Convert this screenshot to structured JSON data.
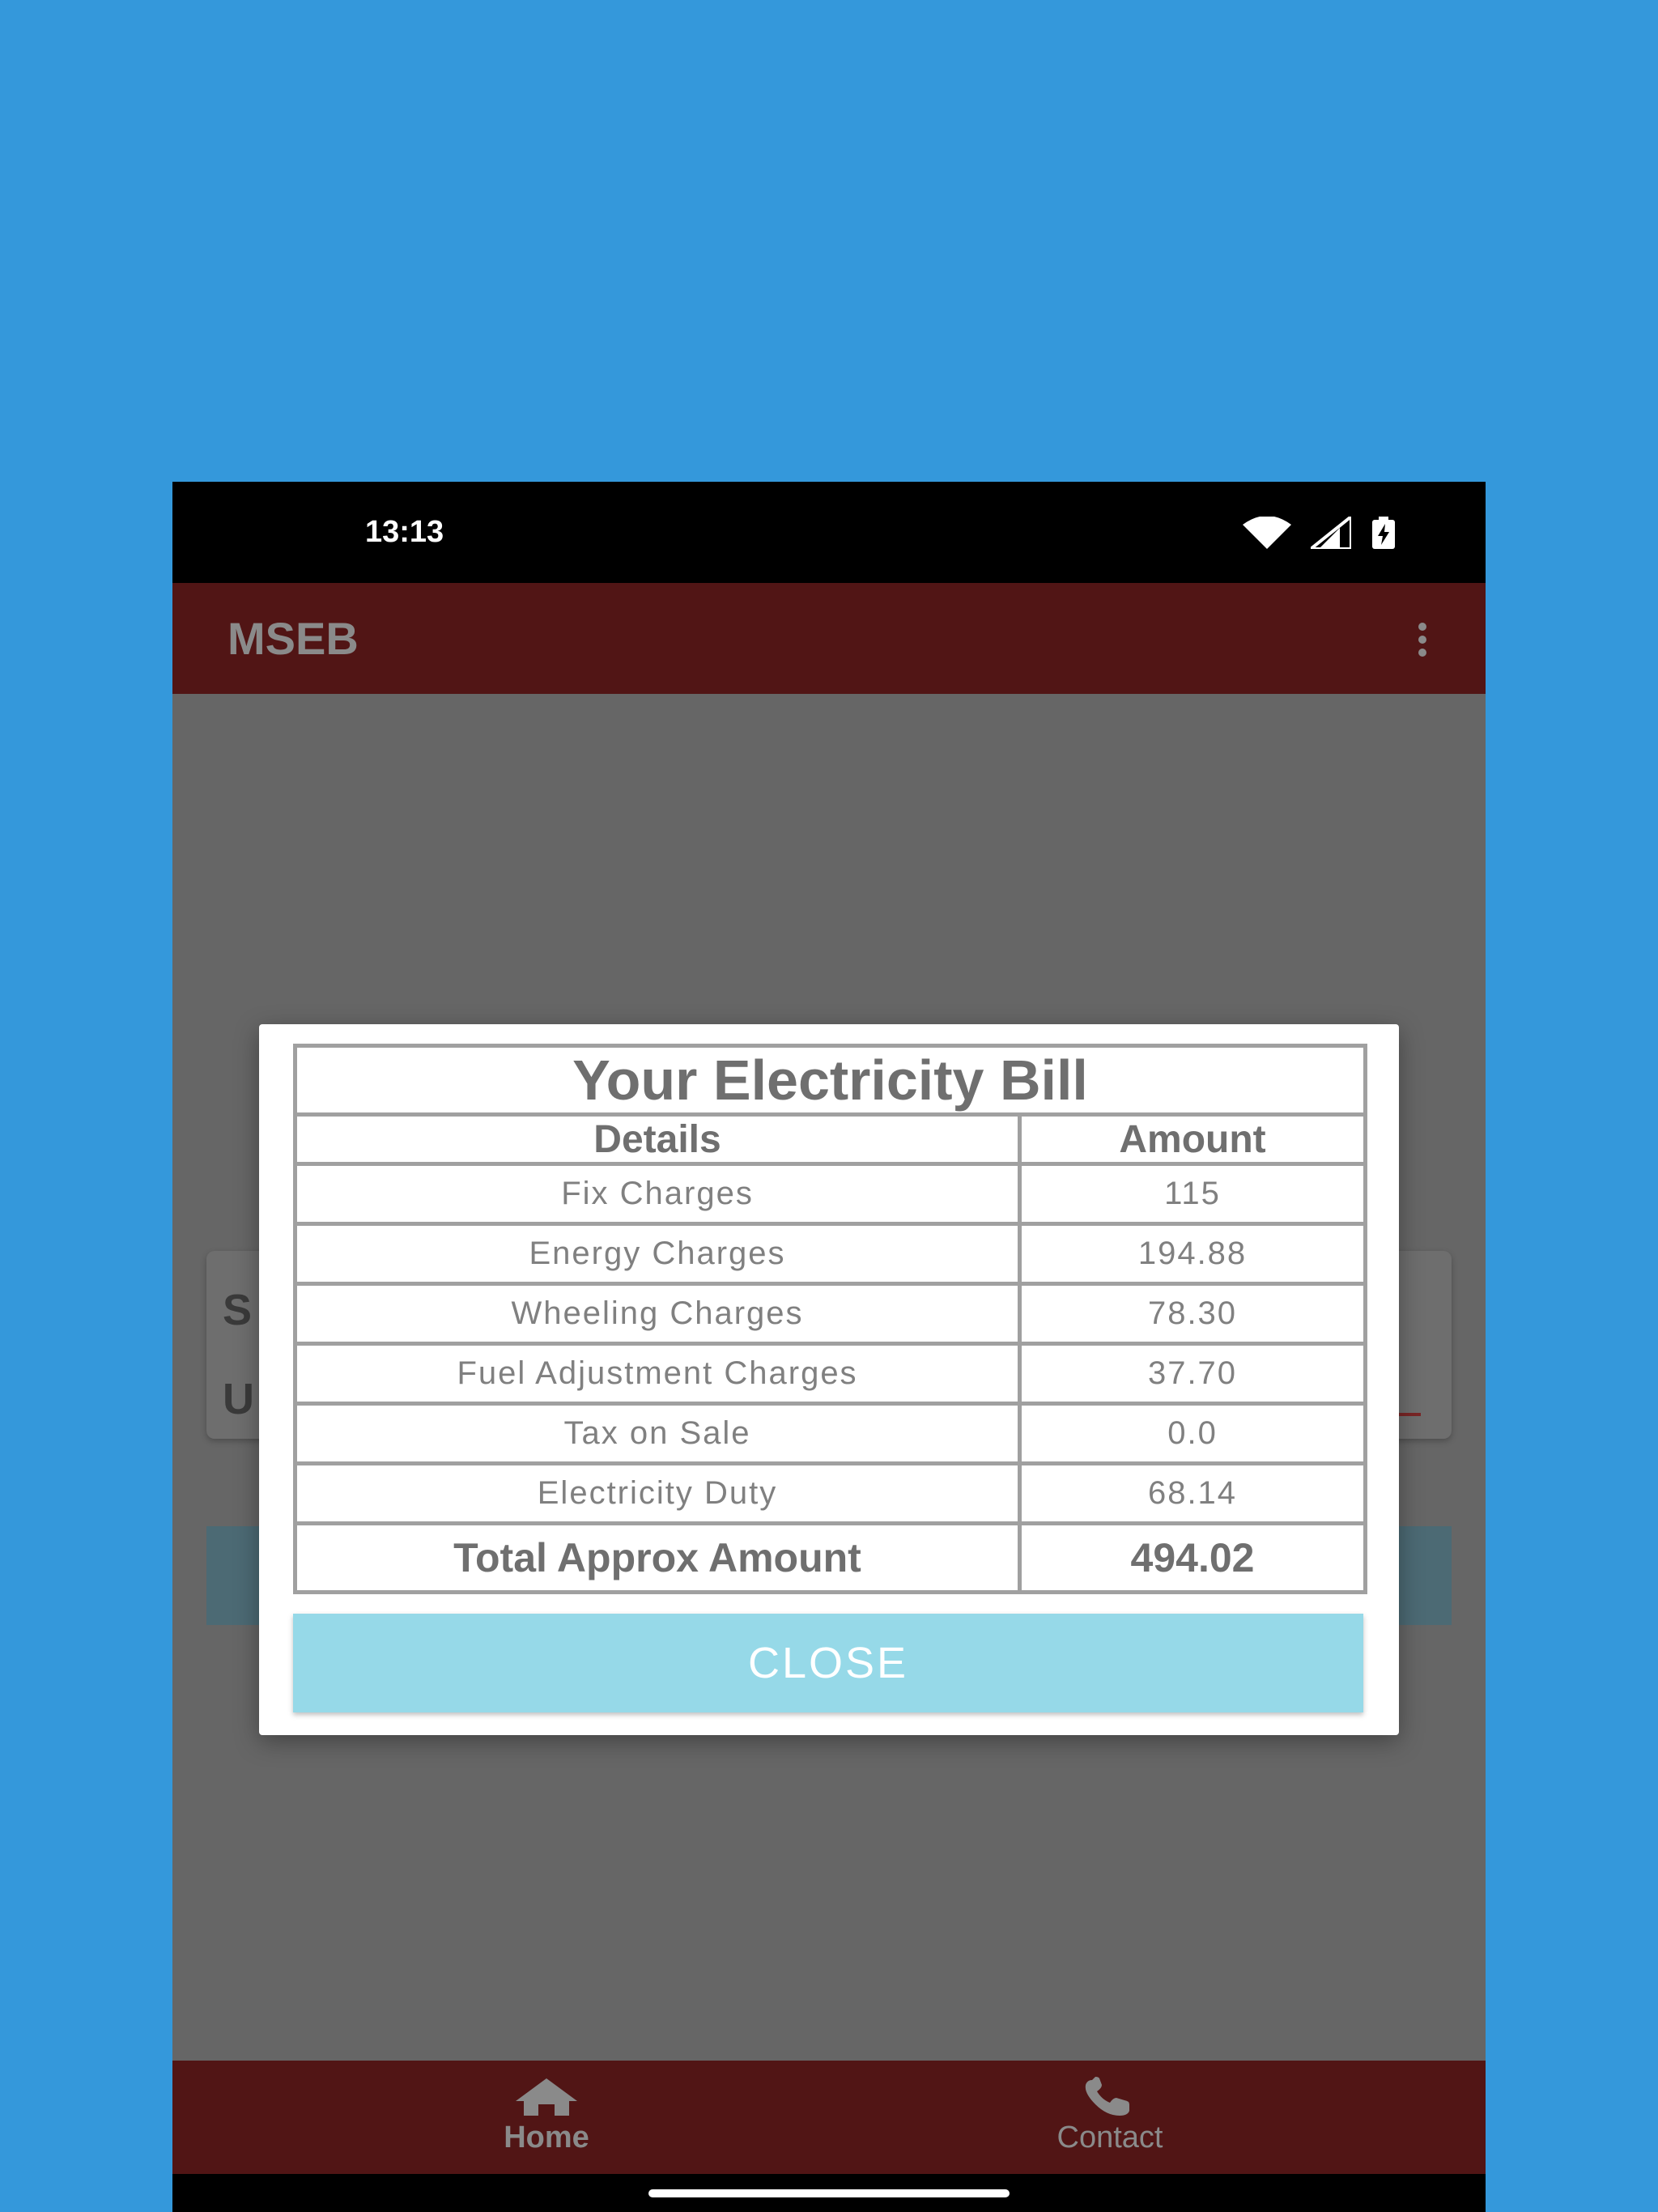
{
  "status_bar": {
    "time": "13:13"
  },
  "app_bar": {
    "title": "MSEB"
  },
  "background_card": {
    "letter_1": "S",
    "letter_2": "U"
  },
  "dialog": {
    "title": "Your Electricity Bill",
    "headers": {
      "details": "Details",
      "amount": "Amount"
    },
    "rows": [
      {
        "label": "Fix Charges",
        "value": "115"
      },
      {
        "label": "Energy Charges",
        "value": "194.88"
      },
      {
        "label": "Wheeling Charges",
        "value": "78.30"
      },
      {
        "label": "Fuel Adjustment Charges",
        "value": "37.70"
      },
      {
        "label": "Tax on Sale",
        "value": "0.0"
      },
      {
        "label": "Electricity Duty",
        "value": "68.14"
      }
    ],
    "total": {
      "label": "Total Approx Amount",
      "value": "494.02"
    },
    "close_label": "CLOSE"
  },
  "bottom_nav": {
    "home_label": "Home",
    "contact_label": "Contact"
  },
  "colors": {
    "page_background": "#3498db",
    "app_bar": "#511515",
    "close_button": "#96d9e8"
  },
  "icons": {
    "wifi": "wifi-icon",
    "signal": "signal-icon",
    "battery": "battery-charging-icon",
    "menu": "more-vert-icon",
    "home": "home-icon",
    "contact": "phone-icon"
  }
}
